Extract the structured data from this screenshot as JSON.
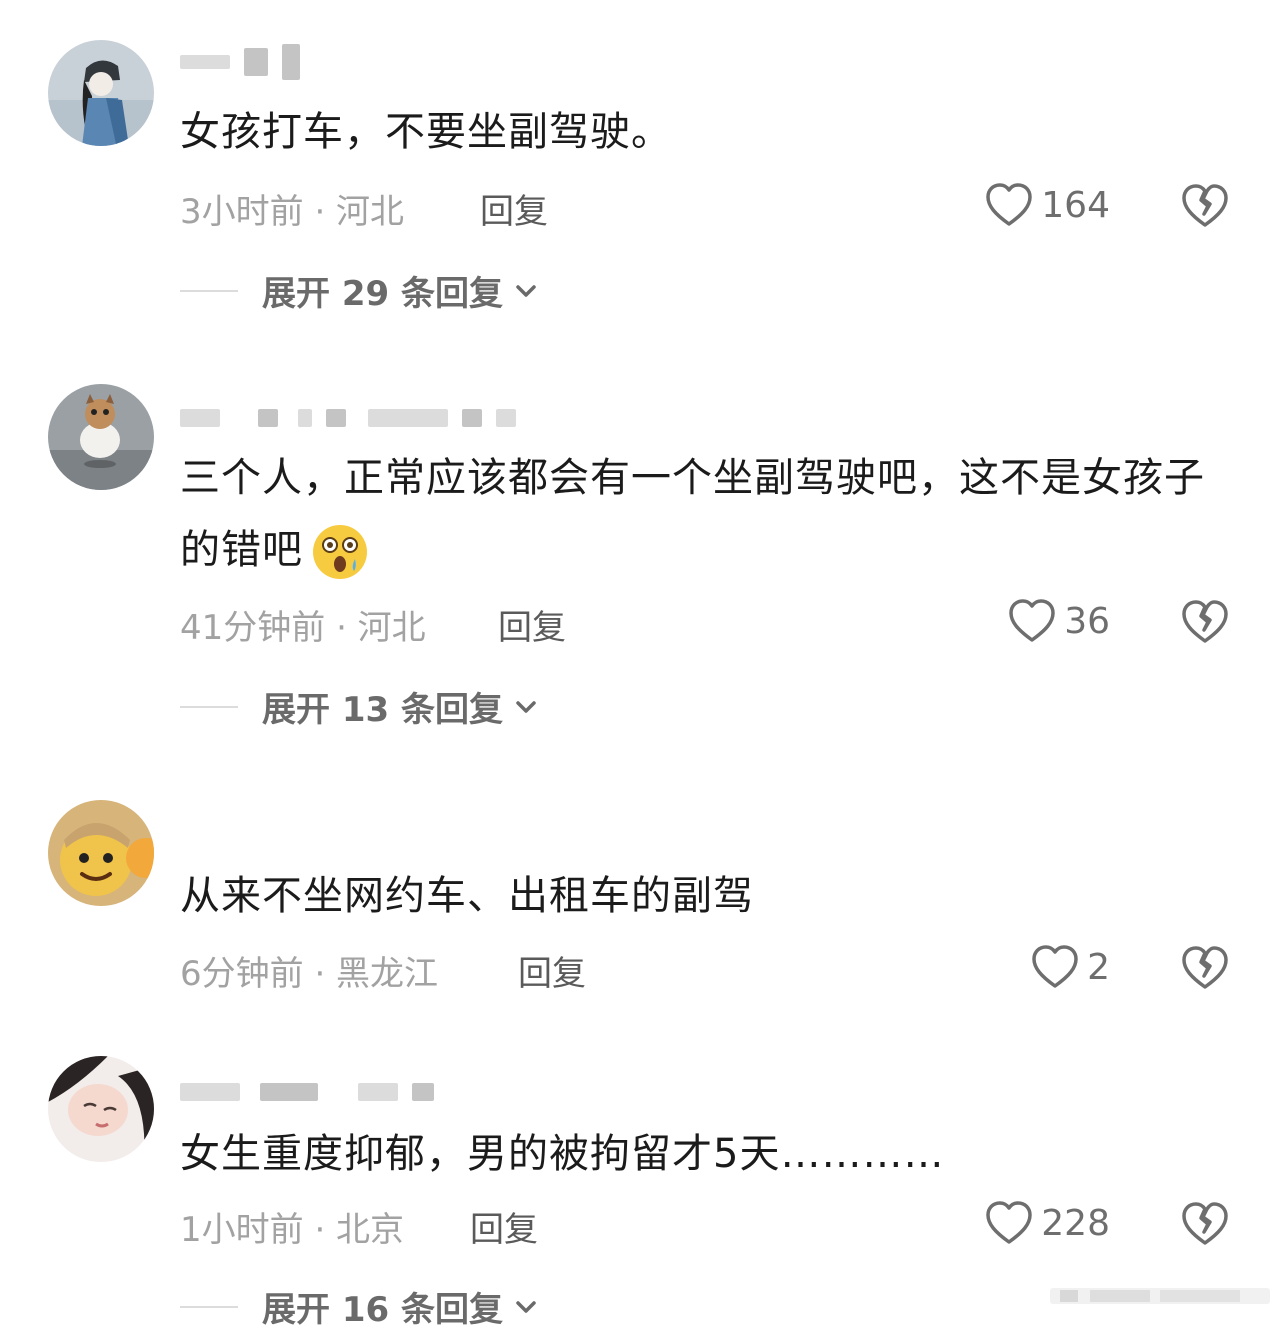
{
  "comments": [
    {
      "text": "女孩打车，不要坐副驾驶。",
      "time_location": "3小时前 · 河北",
      "reply_label": "回复",
      "likes": "164",
      "expand": "展开 29 条回复"
    },
    {
      "text": "三个人，正常应该都会有一个坐副驾驶吧，这不是女孩子的错吧",
      "time_location": "41分钟前 · 河北",
      "reply_label": "回复",
      "likes": "36",
      "expand": "展开 13 条回复",
      "emoji": "astonished-face-emoji"
    },
    {
      "text": "从来不坐网约车、出租车的副驾",
      "time_location": "6分钟前 · 黑龙江",
      "reply_label": "回复",
      "likes": "2"
    },
    {
      "text": "女生重度抑郁，男的被拘留才5天…………",
      "time_location": "1小时前 · 北京",
      "reply_label": "回复",
      "likes": "228",
      "expand": "展开 16 条回复"
    }
  ],
  "icons": {
    "like": "heart-outline-icon",
    "dislike": "broken-heart-icon",
    "expand": "chevron-down-icon"
  }
}
